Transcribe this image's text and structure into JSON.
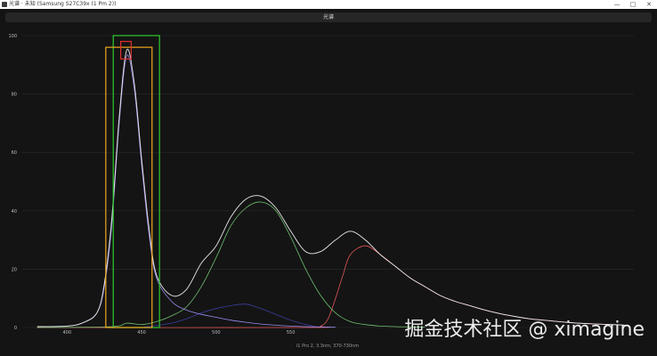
{
  "window": {
    "title": "光谱 · 未知 (Samsung S27C39x (1 Pm 2))",
    "minimize_glyph": "—",
    "maximize_glyph": "□",
    "close_glyph": "✕"
  },
  "toolbar": {
    "label": "光谱"
  },
  "watermark": "掘金技术社区 @ ximagine",
  "chart_data": {
    "type": "line",
    "title": "",
    "xlabel": "i1 Pro 2, 3.3nm, 370-730nm",
    "ylabel": "",
    "xlim": [
      370,
      780
    ],
    "ylim": [
      0,
      100
    ],
    "x_ticks": [
      {
        "value": 400,
        "label": "400"
      },
      {
        "value": 450,
        "label": "450"
      },
      {
        "value": 500,
        "label": "500"
      },
      {
        "value": 550,
        "label": "550"
      }
    ],
    "y_ticks": [
      {
        "value": 0,
        "label": "0"
      },
      {
        "value": 20,
        "label": "20"
      },
      {
        "value": 40,
        "label": "40"
      },
      {
        "value": 60,
        "label": "60"
      },
      {
        "value": 80,
        "label": "80"
      },
      {
        "value": 100,
        "label": "100"
      }
    ],
    "grid": true,
    "colors": {
      "blue": "#9a8cf0",
      "blue_dark": "#3c3ca0",
      "green": "#6fbf6f",
      "red": "#e05555",
      "white": "#e8e8e8",
      "range_box_green": "#2ecc2e",
      "range_box_yellow": "#f0a81e",
      "peak_box_red": "#e03030"
    },
    "series": [
      {
        "key": "white",
        "x": [
          380,
          400,
          410,
          420,
          425,
          430,
          435,
          440,
          445,
          450,
          455,
          460,
          470,
          480,
          490,
          500,
          510,
          520,
          530,
          540,
          550,
          560,
          570,
          580,
          590,
          600,
          610,
          620,
          630,
          640,
          650,
          660,
          670,
          680,
          690,
          700,
          710,
          720,
          730,
          740,
          750,
          760,
          770,
          775
        ],
        "y": [
          0.3,
          0.5,
          1.5,
          5,
          15,
          37,
          72,
          95,
          84,
          58,
          34,
          18,
          11,
          13,
          22,
          28,
          38,
          44,
          45,
          41,
          33,
          26,
          26,
          30,
          33,
          30,
          25,
          21,
          17,
          14,
          11,
          9,
          7.5,
          6,
          4.8,
          3.8,
          3,
          2.5,
          2,
          1.6,
          1.3,
          1.1,
          0.9,
          0.8
        ]
      },
      {
        "key": "blue",
        "x": [
          380,
          400,
          410,
          420,
          425,
          430,
          435,
          440,
          445,
          450,
          455,
          460,
          470,
          480,
          490,
          500,
          510,
          520,
          530,
          540,
          550,
          560,
          570,
          580
        ],
        "y": [
          0.3,
          0.5,
          1.5,
          5,
          14,
          35,
          70,
          93,
          82,
          56,
          32,
          17,
          9,
          6,
          4.5,
          3.5,
          2.5,
          1.8,
          1.2,
          0.8,
          0.5,
          0.3,
          0.2,
          0.1
        ]
      },
      {
        "key": "green",
        "x": [
          380,
          430,
          440,
          450,
          460,
          470,
          480,
          490,
          500,
          510,
          520,
          530,
          540,
          550,
          560,
          570,
          580,
          590,
          600,
          610,
          620,
          630,
          640
        ],
        "y": [
          0,
          0.3,
          1.5,
          1,
          2,
          4,
          7,
          14,
          24,
          35,
          41,
          43,
          40,
          31,
          20,
          11,
          5,
          2,
          1,
          0.5,
          0.3,
          0.2,
          0.1
        ]
      },
      {
        "key": "red",
        "x": [
          380,
          560,
          570,
          575,
          580,
          585,
          590,
          600,
          610,
          620,
          630,
          640,
          650,
          660,
          670,
          680,
          690,
          700,
          710,
          720,
          730,
          740,
          750,
          760,
          770,
          775
        ],
        "y": [
          0,
          0,
          0.5,
          3,
          10,
          18,
          25,
          28,
          25,
          21,
          17,
          14,
          11,
          9,
          7.5,
          6,
          4.8,
          3.8,
          3,
          2.5,
          2,
          1.6,
          1.3,
          1.1,
          0.9,
          0.8
        ]
      },
      {
        "key": "blue_dark",
        "x": [
          450,
          470,
          480,
          490,
          500,
          510,
          520,
          530,
          540,
          550,
          560,
          570
        ],
        "y": [
          0,
          1.5,
          3,
          5,
          6.5,
          7.5,
          8,
          6.5,
          4.5,
          2.5,
          1,
          0
        ]
      }
    ],
    "annotations": [
      {
        "key": "range_box_green",
        "x0": 431,
        "x1": 462,
        "y0": 0,
        "y1": 100
      },
      {
        "key": "range_box_yellow",
        "x0": 426,
        "x1": 457,
        "y0": 0,
        "y1": 96
      },
      {
        "key": "peak_box_red",
        "x0": 436,
        "x1": 443,
        "y0": 92,
        "y1": 98
      }
    ]
  }
}
